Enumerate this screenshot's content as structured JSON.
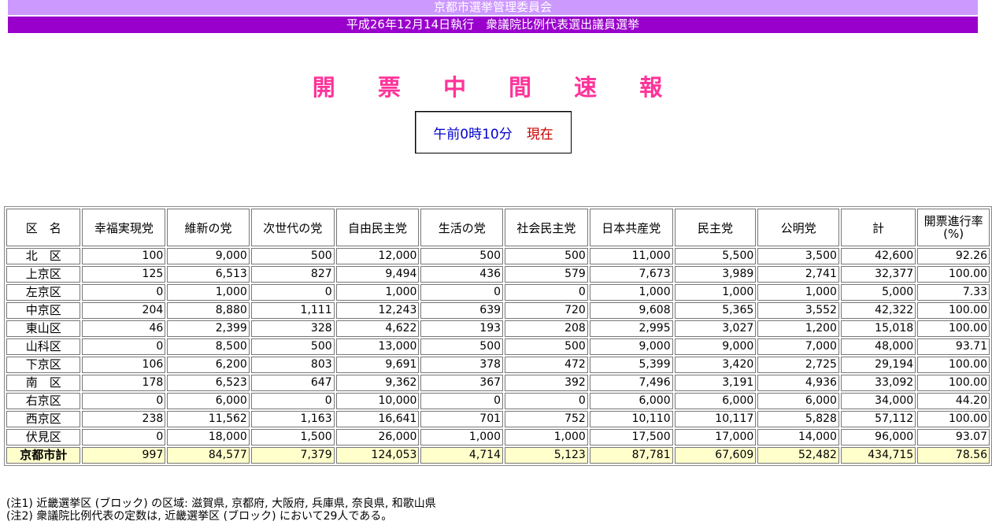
{
  "header": {
    "org": "京都市選挙管理委員会",
    "election": "平成26年12月14日執行　衆議院比例代表選出議員選挙"
  },
  "title": "開 票 中 間 速 報",
  "time": {
    "value": "午前0時10分",
    "suffix": "現在"
  },
  "table": {
    "columns": [
      "区　名",
      "幸福実現党",
      "維新の党",
      "次世代の党",
      "自由民主党",
      "生活の党",
      "社会民主党",
      "日本共産党",
      "民主党",
      "公明党",
      "計",
      "開票進行率 (%)"
    ],
    "rows": [
      [
        "北　区",
        "100",
        "9,000",
        "500",
        "12,000",
        "500",
        "500",
        "11,000",
        "5,500",
        "3,500",
        "42,600",
        "92.26"
      ],
      [
        "上京区",
        "125",
        "6,513",
        "827",
        "9,494",
        "436",
        "579",
        "7,673",
        "3,989",
        "2,741",
        "32,377",
        "100.00"
      ],
      [
        "左京区",
        "0",
        "1,000",
        "0",
        "1,000",
        "0",
        "0",
        "1,000",
        "1,000",
        "1,000",
        "5,000",
        "7.33"
      ],
      [
        "中京区",
        "204",
        "8,880",
        "1,111",
        "12,243",
        "639",
        "720",
        "9,608",
        "5,365",
        "3,552",
        "42,322",
        "100.00"
      ],
      [
        "東山区",
        "46",
        "2,399",
        "328",
        "4,622",
        "193",
        "208",
        "2,995",
        "3,027",
        "1,200",
        "15,018",
        "100.00"
      ],
      [
        "山科区",
        "0",
        "8,500",
        "500",
        "13,000",
        "500",
        "500",
        "9,000",
        "9,000",
        "7,000",
        "48,000",
        "93.71"
      ],
      [
        "下京区",
        "106",
        "6,200",
        "803",
        "9,691",
        "378",
        "472",
        "5,399",
        "3,420",
        "2,725",
        "29,194",
        "100.00"
      ],
      [
        "南　区",
        "178",
        "6,523",
        "647",
        "9,362",
        "367",
        "392",
        "7,496",
        "3,191",
        "4,936",
        "33,092",
        "100.00"
      ],
      [
        "右京区",
        "0",
        "6,000",
        "0",
        "10,000",
        "0",
        "0",
        "6,000",
        "6,000",
        "6,000",
        "34,000",
        "44.20"
      ],
      [
        "西京区",
        "238",
        "11,562",
        "1,163",
        "16,641",
        "701",
        "752",
        "10,110",
        "10,117",
        "5,828",
        "57,112",
        "100.00"
      ],
      [
        "伏見区",
        "0",
        "18,000",
        "1,500",
        "26,000",
        "1,000",
        "1,000",
        "17,500",
        "17,000",
        "14,000",
        "96,000",
        "93.07"
      ]
    ],
    "total": [
      "京都市計",
      "997",
      "84,577",
      "7,379",
      "124,053",
      "4,714",
      "5,123",
      "87,781",
      "67,609",
      "52,482",
      "434,715",
      "78.56"
    ]
  },
  "notes": [
    "(注1) 近畿選挙区 (ブロック) の区域: 滋賀県, 京都府, 大阪府, 兵庫県, 奈良県, 和歌山県",
    "(注2) 衆議院比例代表の定数は, 近畿選挙区 (ブロック) において29人である。"
  ],
  "colors": {
    "band_light": "#cc99ff",
    "band_dark": "#9900cc",
    "title": "#ff3399",
    "time": "#0000cc",
    "now": "#cc0000",
    "total_bg": "#ffffcc"
  }
}
